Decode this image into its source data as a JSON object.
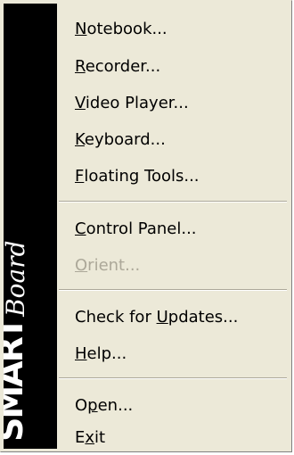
{
  "brand": {
    "smart": "SMART",
    "board": "Board",
    "tm": "™"
  },
  "menu": {
    "items": [
      {
        "pre": "",
        "key": "N",
        "post": "otebook...",
        "enabled": true
      },
      {
        "pre": "",
        "key": "R",
        "post": "ecorder...",
        "enabled": true
      },
      {
        "pre": "",
        "key": "V",
        "post": "ideo Player...",
        "enabled": true
      },
      {
        "pre": "",
        "key": "K",
        "post": "eyboard...",
        "enabled": true
      },
      {
        "pre": "",
        "key": "F",
        "post": "loating Tools...",
        "enabled": true
      },
      {
        "pre": "",
        "key": "C",
        "post": "ontrol Panel...",
        "enabled": true
      },
      {
        "pre": "",
        "key": "O",
        "post": "rient...",
        "enabled": false
      },
      {
        "pre": "Check for ",
        "key": "U",
        "post": "pdates...",
        "enabled": true
      },
      {
        "pre": "",
        "key": "H",
        "post": "elp...",
        "enabled": true
      },
      {
        "pre": "O",
        "key": "p",
        "post": "en...",
        "enabled": true
      },
      {
        "pre": "E",
        "key": "x",
        "post": "it",
        "enabled": true
      }
    ]
  },
  "colors": {
    "menu_background": "#ece9d8",
    "brand_strip": "#000000",
    "disabled_text": "#aca899",
    "separator": "#aca899"
  }
}
